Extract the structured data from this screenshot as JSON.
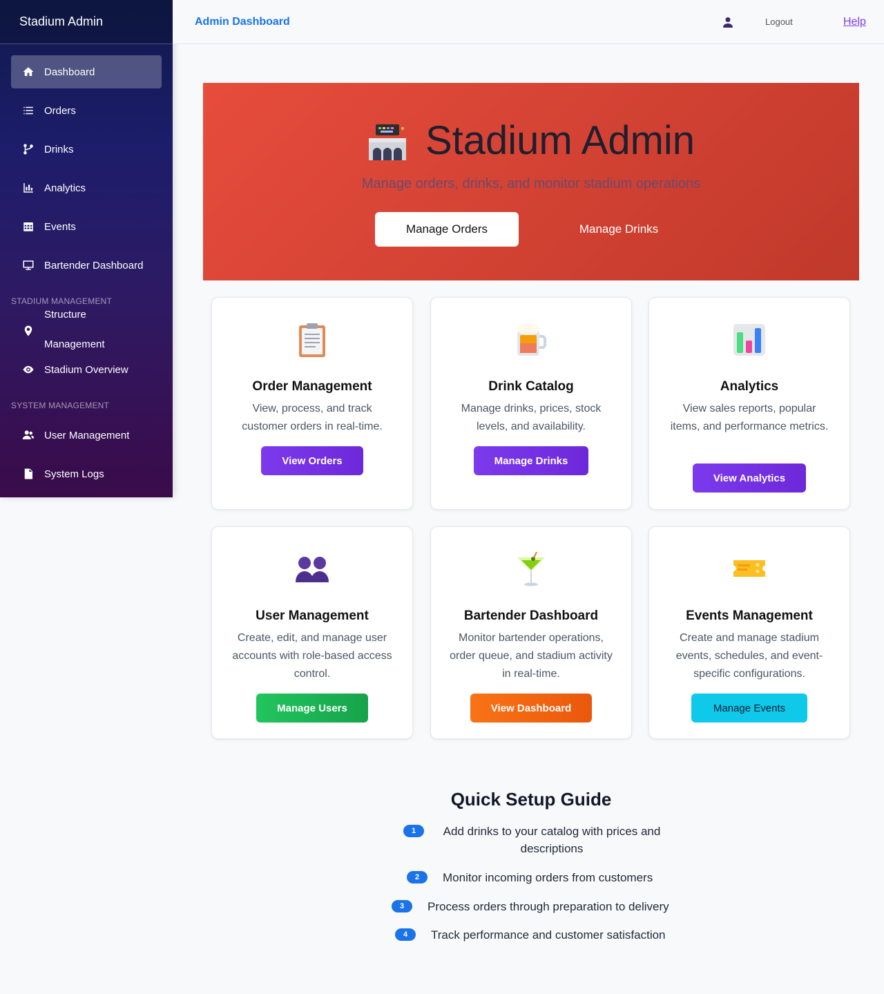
{
  "sidebar": {
    "brand": "Stadium Admin",
    "items": [
      {
        "label": "Dashboard",
        "icon": "home-icon"
      },
      {
        "label": "Orders",
        "icon": "list-icon"
      },
      {
        "label": "Drinks",
        "icon": "branch-icon"
      },
      {
        "label": "Analytics",
        "icon": "bar-chart-icon"
      },
      {
        "label": "Events",
        "icon": "calendar-icon"
      },
      {
        "label": "Bartender Dashboard",
        "icon": "monitor-icon"
      }
    ],
    "section_stadium": "STADIUM MANAGEMENT",
    "stadium_items": [
      {
        "label_line1": "Structure",
        "label_line2": "Management",
        "icon": "map-pin-icon"
      },
      {
        "label": "Stadium Overview",
        "icon": "eye-icon"
      }
    ],
    "section_system": "SYSTEM MANAGEMENT",
    "system_items": [
      {
        "label": "User Management",
        "icon": "users-icon"
      },
      {
        "label": "System Logs",
        "icon": "document-icon"
      }
    ]
  },
  "topbar": {
    "title": "Admin Dashboard",
    "logout": "Logout",
    "help": "Help"
  },
  "hero": {
    "title": "Stadium Admin",
    "subtitle": "Manage orders, drinks, and monitor stadium operations",
    "btn_primary": "Manage Orders",
    "btn_secondary": "Manage Drinks"
  },
  "cards": [
    {
      "title": "Order Management",
      "desc": "View, process, and track customer orders in real-time.",
      "button": "View Orders",
      "icon": "clipboard-icon"
    },
    {
      "title": "Drink Catalog",
      "desc": "Manage drinks, prices, stock levels, and availability.",
      "button": "Manage Drinks",
      "icon": "beer-mug-icon"
    },
    {
      "title": "Analytics",
      "desc": "View sales reports, popular items, and performance metrics.",
      "button": "View Analytics",
      "icon": "bar-chart-icon"
    },
    {
      "title": "User Management",
      "desc": "Create, edit, and manage user accounts with role-based access control.",
      "button": "Manage Users",
      "icon": "users-icon"
    },
    {
      "title": "Bartender Dashboard",
      "desc": "Monitor bartender operations, order queue, and stadium activity in real-time.",
      "button": "View Dashboard",
      "icon": "cocktail-icon"
    },
    {
      "title": "Events Management",
      "desc": "Create and manage stadium events, schedules, and event-specific configurations.",
      "button": "Manage Events",
      "icon": "ticket-icon"
    }
  ],
  "guide": {
    "title": "Quick Setup Guide",
    "steps": [
      {
        "num": "1",
        "text": "Add drinks to your catalog with prices and descriptions"
      },
      {
        "num": "2",
        "text": "Monitor incoming orders from customers"
      },
      {
        "num": "3",
        "text": "Process orders through preparation to delivery"
      },
      {
        "num": "4",
        "text": "Track performance and customer satisfaction"
      }
    ]
  }
}
